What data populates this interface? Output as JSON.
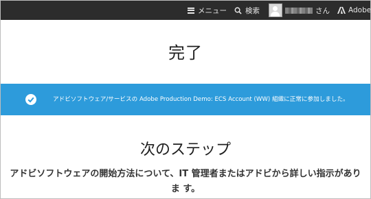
{
  "header": {
    "menu_label": "メニュー",
    "search_label": "検索",
    "user_suffix": "さん",
    "adobe_label": "Adobe"
  },
  "main": {
    "title": "完了",
    "banner_text": "アドビソフトウェア/サービスの Adobe Production Demo: ECS Account (WW) 組織に正常に参加しました。",
    "next_steps_title": "次のステップ",
    "next_steps_body": "アドビソフトウェアの開始方法について、IT 管理者またはアドビから詳しい指示がありま す。"
  },
  "colors": {
    "topbar": "#2c2c2c",
    "banner": "#2d9bdb"
  },
  "icons": [
    "hamburger-icon",
    "search-icon",
    "avatar",
    "adobe-logo-icon",
    "checkmark-icon"
  ]
}
